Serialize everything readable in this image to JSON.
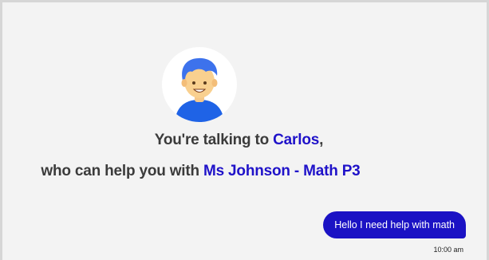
{
  "agent": {
    "intro_prefix": "You're talking to ",
    "name": "Carlos",
    "intro_suffix": ",",
    "help_prefix": "who can help you with ",
    "subject": "Ms Johnson - Math P3",
    "avatar_icon": "user-avatar-icon"
  },
  "messages": [
    {
      "text": "Hello I need help with math",
      "time": "10:00 am",
      "sender": "user"
    }
  ],
  "colors": {
    "accent": "#1f12c9",
    "bubble": "#1b12c4",
    "background": "#f3f3f3"
  }
}
